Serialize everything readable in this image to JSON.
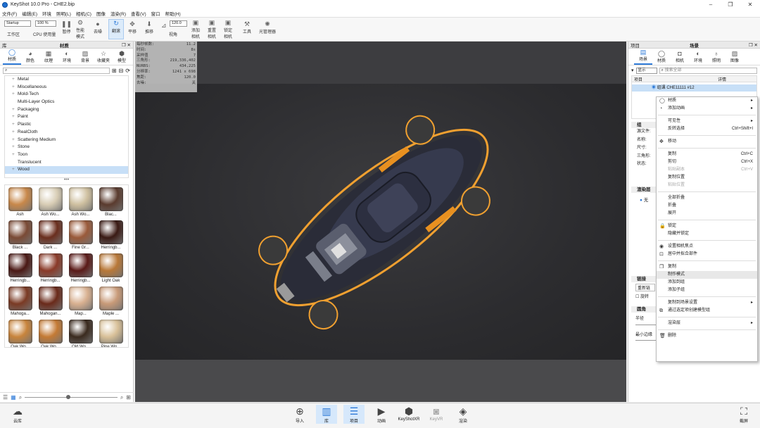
{
  "window": {
    "title": "KeyShot 10.0 Pro  -  CHE2.bip",
    "controls": [
      "–",
      "❐",
      "✕"
    ]
  },
  "menu": [
    "文件(F)",
    "编辑(E)",
    "环境",
    "照明(L)",
    "相机(C)",
    "图像",
    "渲染(R)",
    "查看(V)",
    "窗口",
    "帮助(H)"
  ],
  "toolbar": {
    "workspace_select": "Startup",
    "workspace_label": "工作区",
    "cpu_select": "100 %",
    "cpu_label": "CPU 使用量",
    "pause": "暂停",
    "perf_mode": "性能\n模式",
    "denoise": "去噪",
    "tumble": "翻滚",
    "pan": "平移",
    "dolly": "推移",
    "fov_value": "120.0",
    "fov_label": "视角",
    "add_camera": "添加\n相机",
    "reset_camera": "重置\n相机",
    "lock_camera": "锁定\n相机",
    "tools": "工具",
    "light_manager": "光管理器"
  },
  "library": {
    "header": "库",
    "header_center": "材质",
    "tabs": [
      "材质",
      "颜色",
      "纹理",
      "环境",
      "背景",
      "收藏夹",
      "模型"
    ],
    "tree": [
      "Metal",
      "Miscellaneous",
      "Mold-Tech",
      "Multi-Layer Optics",
      "Packaging",
      "Paint",
      "Plastic",
      "RealCloth",
      "Scattering Medium",
      "Stone",
      "Toon",
      "Translucent",
      "Wood"
    ],
    "tree_expandable": [
      true,
      true,
      true,
      false,
      true,
      true,
      true,
      true,
      true,
      true,
      true,
      false,
      true
    ],
    "selected": "Wood",
    "materials": [
      {
        "label": "Ash",
        "color": "#c8884a"
      },
      {
        "label": "Ash Wo...",
        "color": "#d8cdb5"
      },
      {
        "label": "Ash Wo...",
        "color": "#cfc0a0"
      },
      {
        "label": "Blac...",
        "color": "#5a3b2e"
      },
      {
        "label": "Black ...",
        "color": "#7a4a35"
      },
      {
        "label": "Dark ...",
        "color": "#6a2e1e"
      },
      {
        "label": "Fine Gr...",
        "color": "#9a5a3a"
      },
      {
        "label": "Herringb...",
        "color": "#3a1a14"
      },
      {
        "label": "Herringb...",
        "color": "#4a1814"
      },
      {
        "label": "Herringb...",
        "color": "#8a3a28"
      },
      {
        "label": "Herringb...",
        "color": "#5a1a18"
      },
      {
        "label": "Light Oak",
        "color": "#b87838"
      },
      {
        "label": "Mahoga...",
        "color": "#7a3a24"
      },
      {
        "label": "Mahogan...",
        "color": "#6a2a1a"
      },
      {
        "label": "Map...",
        "color": "#d8b090"
      },
      {
        "label": "Maple ...",
        "color": "#c89a78"
      },
      {
        "label": "Oak Wo...",
        "color": "#c8843c"
      },
      {
        "label": "Oak Wo...",
        "color": "#c47a34"
      },
      {
        "label": "Old Wo...",
        "color": "#3a2a1e"
      },
      {
        "label": "Pine Wo...",
        "color": "#d8c098"
      },
      {
        "label": "",
        "color": "#d4b080"
      },
      {
        "label": "",
        "color": "#b8642c"
      },
      {
        "label": "",
        "color": "#3c2418"
      }
    ]
  },
  "stats": [
    [
      "每秒帧数:",
      "11.2"
    ],
    [
      "时间:",
      "8s"
    ],
    [
      "采样值",
      "7"
    ],
    [
      "三角形:",
      "219,336,402"
    ],
    [
      "NURBS:",
      "434,225"
    ],
    [
      "分辨率:",
      "1241 x 698"
    ],
    [
      "焦距:",
      "120.0"
    ],
    [
      "去噪:",
      "关"
    ]
  ],
  "scene": {
    "header": "项目",
    "header_center": "场景",
    "tabs": [
      "场景",
      "材质",
      "相机",
      "环境",
      "照明",
      "图像"
    ],
    "filter": "显示",
    "search_placeholder": "搜索全部",
    "col_item": "项目",
    "col_detail": "详情",
    "model_row": "组课 CHE11111 #12",
    "props_header": "组",
    "props": [
      "源文件:",
      "名称:",
      "尺寸:",
      "三角形:",
      "状态:"
    ],
    "render_header": "渲染层",
    "render_item": "无",
    "pattern_header": "链接",
    "pattern_btn": "重新链",
    "pattern_rot": "旋转",
    "round_header": "圆角",
    "round_r": "半径",
    "round_min": "最小边缘"
  },
  "context_menu": [
    {
      "label": "材质",
      "icon": "◯",
      "arrow": true
    },
    {
      "label": "添加动画",
      "icon": "◔",
      "arrow": true
    },
    {
      "sep": true
    },
    {
      "label": "可见性",
      "arrow": true
    },
    {
      "label": "反转选择",
      "shortcut": "Ctrl+Shift+I"
    },
    {
      "sep": true
    },
    {
      "label": "移动",
      "icon": "✥"
    },
    {
      "sep": true
    },
    {
      "label": "复制",
      "shortcut": "Ctrl+C"
    },
    {
      "label": "剪切",
      "shortcut": "Ctrl+X"
    },
    {
      "label": "粘贴副本",
      "shortcut": "Ctrl+V",
      "disabled": true
    },
    {
      "label": "复制位置"
    },
    {
      "label": "粘贴位置",
      "disabled": true
    },
    {
      "sep": true
    },
    {
      "label": "全部折叠"
    },
    {
      "label": "折叠"
    },
    {
      "label": "展开"
    },
    {
      "sep": true
    },
    {
      "label": "锁定",
      "icon": "🔒"
    },
    {
      "label": "隐藏并锁定"
    },
    {
      "sep": true
    },
    {
      "label": "设置相机焦点",
      "icon": "◉"
    },
    {
      "label": "居中并拟合部件",
      "icon": "⊡"
    },
    {
      "sep": true
    },
    {
      "label": "复制",
      "icon": "❐"
    },
    {
      "label": "制作模式",
      "hover": true
    },
    {
      "label": "添加到组"
    },
    {
      "label": "添加子组"
    },
    {
      "sep": true
    },
    {
      "label": "复制到场景设置",
      "arrow": true
    },
    {
      "label": "通过选定项创建模型组",
      "icon": "⧉"
    },
    {
      "sep": true
    },
    {
      "label": "渲染层",
      "arrow": true
    },
    {
      "sep": true
    },
    {
      "label": "删除",
      "icon": "🗑"
    }
  ],
  "dock": {
    "cloud": "云库",
    "import": "导入",
    "library": "库",
    "project": "项目",
    "animation": "动画",
    "keyshotxr": "KeyShotXR",
    "keyvr": "KeyVR",
    "render": "渲染",
    "screenshot": "截屏"
  }
}
